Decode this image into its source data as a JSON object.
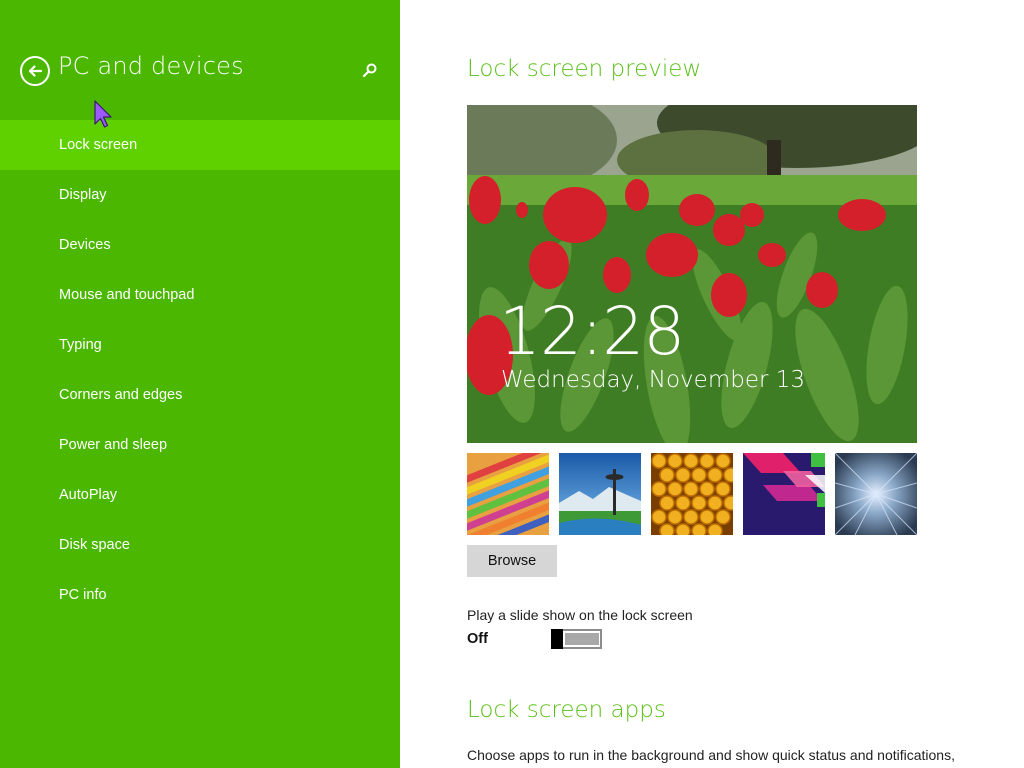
{
  "sidebar": {
    "title": "PC and devices",
    "items": [
      {
        "label": "Lock screen",
        "selected": true
      },
      {
        "label": "Display"
      },
      {
        "label": "Devices"
      },
      {
        "label": "Mouse and touchpad"
      },
      {
        "label": "Typing"
      },
      {
        "label": "Corners and edges"
      },
      {
        "label": "Power and sleep"
      },
      {
        "label": "AutoPlay"
      },
      {
        "label": "Disk space"
      },
      {
        "label": "PC info"
      }
    ],
    "icons": {
      "back": "back-arrow-icon",
      "search": "search-icon"
    }
  },
  "main": {
    "preview_title": "Lock screen preview",
    "preview": {
      "time": "12:28",
      "date": "Wednesday, November 13"
    },
    "thumbnails": [
      "colorful-stripes",
      "space-needle-landscape",
      "honeycomb",
      "abstract-shapes",
      "tunnel-lights"
    ],
    "browse_label": "Browse",
    "slideshow": {
      "label": "Play a slide show on the lock screen",
      "state": "Off",
      "on": false
    },
    "apps_title": "Lock screen apps",
    "apps_description": "Choose apps to run in the background and show quick status and notifications,"
  },
  "colors": {
    "sidebar_bg": "#4cb700",
    "selected_item_bg": "#5fd100",
    "accent_title": "#5cbf1a"
  }
}
